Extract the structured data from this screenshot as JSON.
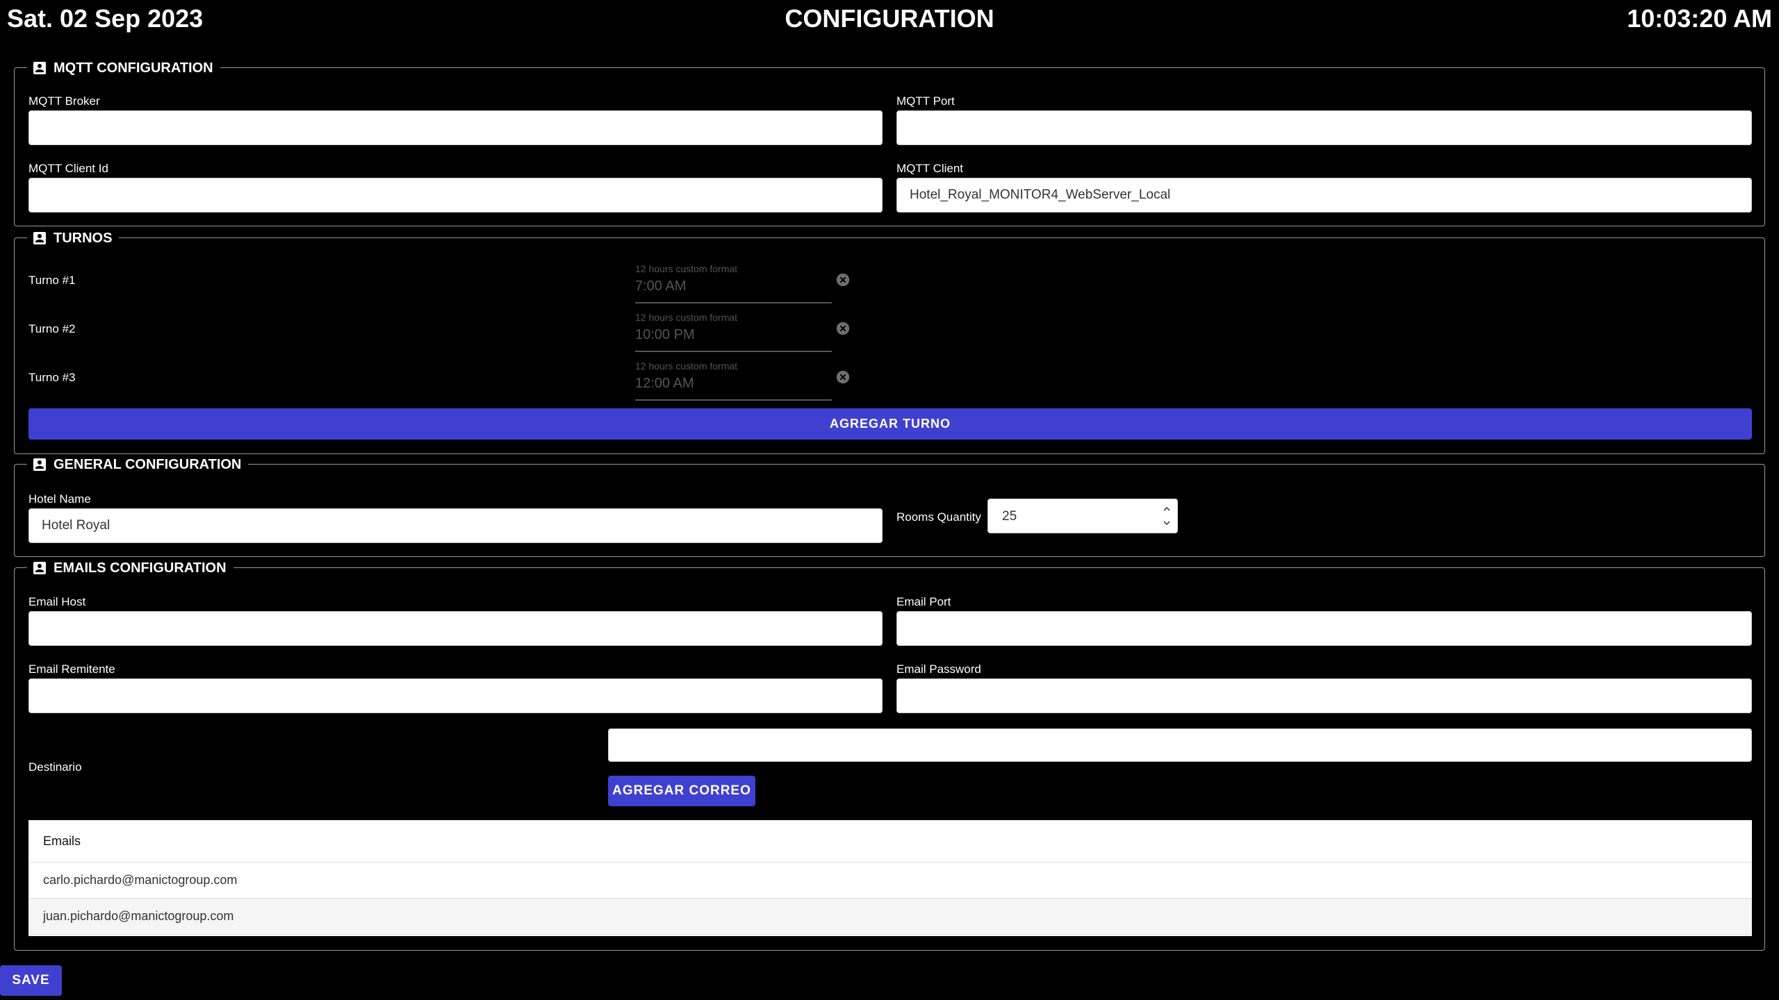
{
  "header": {
    "date": "Sat. 02 Sep 2023",
    "title": "CONFIGURATION",
    "time": "10:03:20 AM"
  },
  "mqtt": {
    "legend": "MQTT CONFIGURATION",
    "broker_label": "MQTT Broker",
    "broker_value": "",
    "port_label": "MQTT Port",
    "port_value": "",
    "client_id_label": "MQTT Client Id",
    "client_id_value": "",
    "client_label": "MQTT Client",
    "client_value": "Hotel_Royal_MONITOR4_WebServer_Local"
  },
  "turnos": {
    "legend": "TURNOS",
    "hint": "12 hours custom format",
    "items": [
      {
        "label": "Turno #1",
        "value": "7:00 AM"
      },
      {
        "label": "Turno #2",
        "value": "10:00 PM"
      },
      {
        "label": "Turno #3",
        "value": "12:00 AM"
      }
    ],
    "add_button": "AGREGAR TURNO"
  },
  "general": {
    "legend": "GENERAL CONFIGURATION",
    "hotel_name_label": "Hotel Name",
    "hotel_name_value": "Hotel Royal",
    "rooms_label": "Rooms Quantity",
    "rooms_value": "25"
  },
  "emails": {
    "legend": "EMAILS CONFIGURATION",
    "host_label": "Email Host",
    "host_value": "",
    "port_label": "Email Port",
    "port_value": "",
    "sender_label": "Email Remitente",
    "sender_value": "",
    "password_label": "Email Password",
    "password_value": "",
    "destination_label": "Destinario",
    "destination_value": "",
    "add_button": "AGREGAR CORREO",
    "table_header": "Emails",
    "list": [
      "carlo.pichardo@manictogroup.com",
      "juan.pichardo@manictogroup.com"
    ]
  },
  "footer": {
    "save_button": "SAVE"
  },
  "colors": {
    "background": "#000000",
    "primary_button": "#4040d0",
    "border": "#9a9a9a"
  },
  "icons": {
    "section": "account-box-icon",
    "clear": "clear-circle-icon",
    "spinner": "spinner-arrows-icon"
  }
}
